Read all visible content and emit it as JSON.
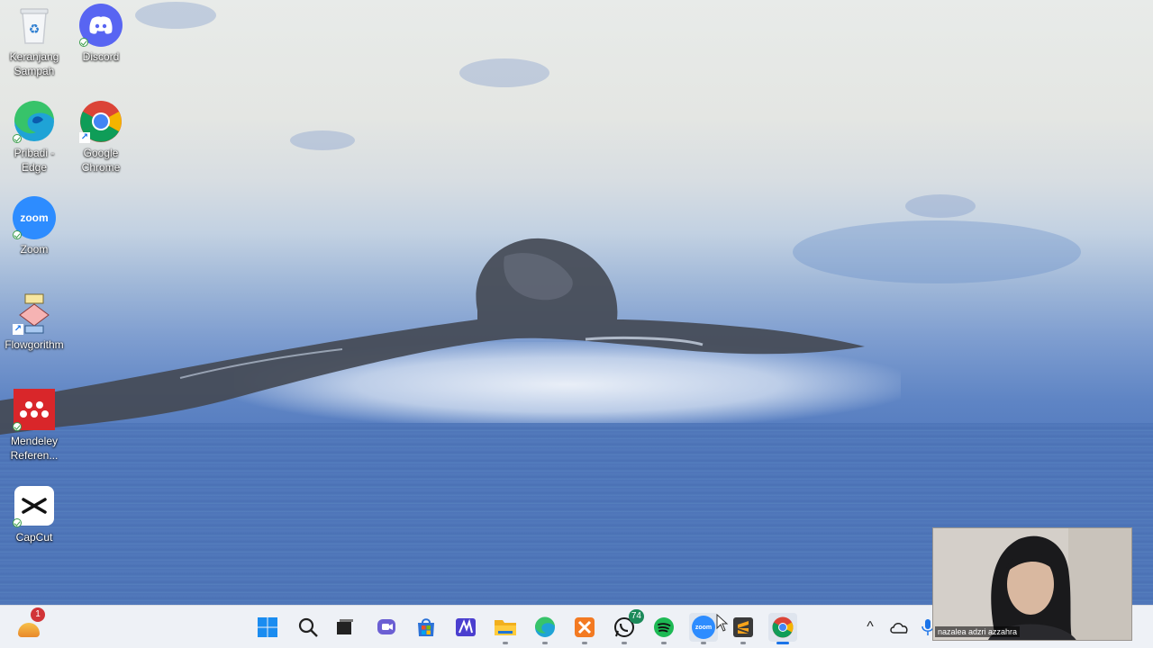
{
  "desktop": {
    "icons": [
      {
        "label": "Keranjang Sampah",
        "icon": "recycle-bin-icon"
      },
      {
        "label": "Discord",
        "icon": "discord-icon"
      },
      {
        "label": "Pribadi - Edge",
        "icon": "edge-icon"
      },
      {
        "label": "Google Chrome",
        "icon": "chrome-icon"
      },
      {
        "label": "Zoom",
        "icon": "zoom-icon",
        "glyph_text": "zoom"
      },
      {
        "label": "Flowgorithm",
        "icon": "flowgorithm-icon"
      },
      {
        "label": "Mendeley Referen...",
        "icon": "mendeley-icon"
      },
      {
        "label": "CapCut",
        "icon": "capcut-icon"
      }
    ]
  },
  "taskbar": {
    "widgets_badge": "1",
    "apps": [
      {
        "name": "start",
        "icon": "windows-start-icon"
      },
      {
        "name": "search",
        "icon": "search-icon"
      },
      {
        "name": "task-view",
        "icon": "task-view-icon"
      },
      {
        "name": "chat",
        "icon": "chat-icon"
      },
      {
        "name": "store",
        "icon": "microsoft-store-icon"
      },
      {
        "name": "vscode-like",
        "icon": "editor-icon"
      },
      {
        "name": "file-explorer",
        "icon": "folder-icon"
      },
      {
        "name": "edge",
        "icon": "edge-icon"
      },
      {
        "name": "xampp",
        "icon": "xampp-icon"
      },
      {
        "name": "whatsapp",
        "icon": "whatsapp-icon",
        "badge": "74"
      },
      {
        "name": "spotify",
        "icon": "spotify-icon"
      },
      {
        "name": "zoom",
        "icon": "zoom-icon",
        "glyph_text": "zoom"
      },
      {
        "name": "sublime-text",
        "icon": "sublime-icon"
      },
      {
        "name": "chrome",
        "icon": "chrome-icon"
      }
    ],
    "tray": {
      "chevron": "^"
    }
  },
  "webcam": {
    "participant_name": "nazalea adzri azzahra"
  },
  "colors": {
    "discord": "#5865f2",
    "zoom": "#2d8cff",
    "mendeley": "#d9262a",
    "taskbar_bg": "#eef1f6"
  }
}
